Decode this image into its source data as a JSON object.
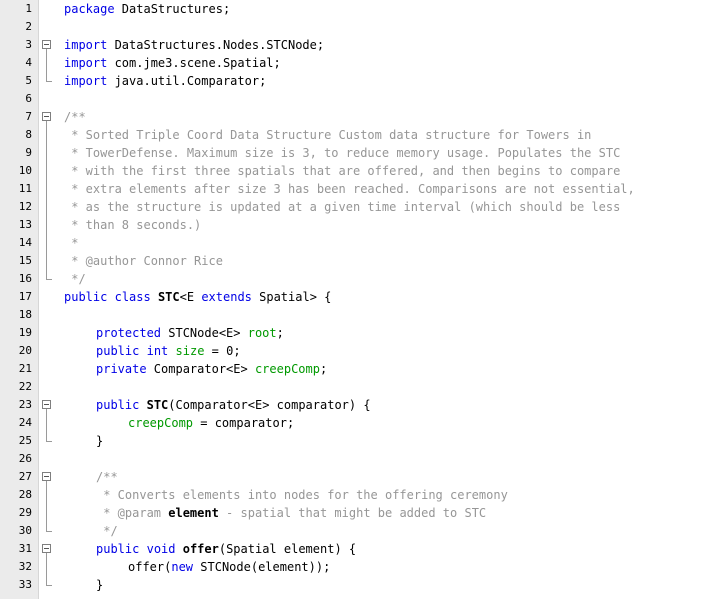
{
  "colors": {
    "keyword": "#0000e6",
    "comment": "#969696",
    "field": "#009900",
    "plain": "#000000",
    "gutter": "#ebebeb"
  },
  "lines": [
    {
      "n": "1",
      "indent": 0,
      "fold": "none",
      "t": [
        {
          "x": "package",
          "c": "kw"
        },
        {
          "x": " DataStructures;"
        }
      ]
    },
    {
      "n": "2",
      "indent": 0,
      "fold": "none",
      "t": []
    },
    {
      "n": "3",
      "indent": 0,
      "fold": "start",
      "t": [
        {
          "x": "import",
          "c": "kw"
        },
        {
          "x": " DataStructures.Nodes.STCNode;"
        }
      ]
    },
    {
      "n": "4",
      "indent": 0,
      "fold": "cont",
      "t": [
        {
          "x": "import",
          "c": "kw"
        },
        {
          "x": " com.jme3.scene.Spatial;"
        }
      ]
    },
    {
      "n": "5",
      "indent": 0,
      "fold": "end",
      "t": [
        {
          "x": "import",
          "c": "kw"
        },
        {
          "x": " java.util.Comparator;"
        }
      ]
    },
    {
      "n": "6",
      "indent": 0,
      "fold": "none",
      "t": []
    },
    {
      "n": "7",
      "indent": 0,
      "fold": "start",
      "t": [
        {
          "x": "/**",
          "c": "cm"
        }
      ]
    },
    {
      "n": "8",
      "indent": 0,
      "fold": "cont",
      "t": [
        {
          "x": " * Sorted Triple Coord Data Structure Custom data structure for Towers in",
          "c": "cm"
        }
      ]
    },
    {
      "n": "9",
      "indent": 0,
      "fold": "cont",
      "t": [
        {
          "x": " * TowerDefense. Maximum size is 3, to reduce memory usage. Populates the STC",
          "c": "cm"
        }
      ]
    },
    {
      "n": "10",
      "indent": 0,
      "fold": "cont",
      "t": [
        {
          "x": " * with the first three spatials that are offered, and then begins to compare",
          "c": "cm"
        }
      ]
    },
    {
      "n": "11",
      "indent": 0,
      "fold": "cont",
      "t": [
        {
          "x": " * extra elements after size 3 has been reached. Comparisons are not essential,",
          "c": "cm"
        }
      ]
    },
    {
      "n": "12",
      "indent": 0,
      "fold": "cont",
      "t": [
        {
          "x": " * as the structure is updated at a given time interval (which should be less",
          "c": "cm"
        }
      ]
    },
    {
      "n": "13",
      "indent": 0,
      "fold": "cont",
      "t": [
        {
          "x": " * than 8 seconds.)",
          "c": "cm"
        }
      ]
    },
    {
      "n": "14",
      "indent": 0,
      "fold": "cont",
      "t": [
        {
          "x": " *",
          "c": "cm"
        }
      ]
    },
    {
      "n": "15",
      "indent": 0,
      "fold": "cont",
      "t": [
        {
          "x": " * @author Connor Rice",
          "c": "cm"
        }
      ]
    },
    {
      "n": "16",
      "indent": 0,
      "fold": "end",
      "t": [
        {
          "x": " */",
          "c": "cm"
        }
      ]
    },
    {
      "n": "17",
      "indent": 0,
      "fold": "none",
      "t": [
        {
          "x": "public",
          "c": "kw"
        },
        {
          "x": " "
        },
        {
          "x": "class",
          "c": "kw"
        },
        {
          "x": " "
        },
        {
          "x": "STC",
          "c": "bd"
        },
        {
          "x": "<E "
        },
        {
          "x": "extends",
          "c": "kw"
        },
        {
          "x": " Spatial> {"
        }
      ]
    },
    {
      "n": "18",
      "indent": 0,
      "fold": "none",
      "t": []
    },
    {
      "n": "19",
      "indent": 1,
      "fold": "none",
      "t": [
        {
          "x": "protected",
          "c": "kw"
        },
        {
          "x": " STCNode<E> "
        },
        {
          "x": "root",
          "c": "fld"
        },
        {
          "x": ";"
        }
      ]
    },
    {
      "n": "20",
      "indent": 1,
      "fold": "none",
      "t": [
        {
          "x": "public",
          "c": "kw"
        },
        {
          "x": " "
        },
        {
          "x": "int",
          "c": "kw"
        },
        {
          "x": " "
        },
        {
          "x": "size",
          "c": "fld"
        },
        {
          "x": " = 0;"
        }
      ]
    },
    {
      "n": "21",
      "indent": 1,
      "fold": "none",
      "t": [
        {
          "x": "private",
          "c": "kw"
        },
        {
          "x": " Comparator<E> "
        },
        {
          "x": "creepComp",
          "c": "fld"
        },
        {
          "x": ";"
        }
      ]
    },
    {
      "n": "22",
      "indent": 0,
      "fold": "none",
      "t": []
    },
    {
      "n": "23",
      "indent": 1,
      "fold": "start",
      "t": [
        {
          "x": "public",
          "c": "kw"
        },
        {
          "x": " "
        },
        {
          "x": "STC",
          "c": "bd"
        },
        {
          "x": "(Comparator<E> comparator) {"
        }
      ]
    },
    {
      "n": "24",
      "indent": 2,
      "fold": "cont",
      "t": [
        {
          "x": "creepComp",
          "c": "fld"
        },
        {
          "x": " = comparator;"
        }
      ]
    },
    {
      "n": "25",
      "indent": 1,
      "fold": "end",
      "t": [
        {
          "x": "}"
        }
      ]
    },
    {
      "n": "26",
      "indent": 0,
      "fold": "none",
      "t": []
    },
    {
      "n": "27",
      "indent": 1,
      "fold": "start",
      "t": [
        {
          "x": "/**",
          "c": "cm"
        }
      ]
    },
    {
      "n": "28",
      "indent": 1,
      "fold": "cont",
      "t": [
        {
          "x": " * Converts elements into nodes for the offering ceremony",
          "c": "cm"
        }
      ]
    },
    {
      "n": "29",
      "indent": 1,
      "fold": "cont",
      "t": [
        {
          "x": " * @param ",
          "c": "cm"
        },
        {
          "x": "element",
          "c": "bd"
        },
        {
          "x": " - spatial that might be added to STC",
          "c": "cm"
        }
      ]
    },
    {
      "n": "30",
      "indent": 1,
      "fold": "end",
      "t": [
        {
          "x": " */",
          "c": "cm"
        }
      ]
    },
    {
      "n": "31",
      "indent": 1,
      "fold": "start",
      "t": [
        {
          "x": "public",
          "c": "kw"
        },
        {
          "x": " "
        },
        {
          "x": "void",
          "c": "kw"
        },
        {
          "x": " "
        },
        {
          "x": "offer",
          "c": "bd"
        },
        {
          "x": "(Spatial element) {"
        }
      ]
    },
    {
      "n": "32",
      "indent": 2,
      "fold": "cont",
      "t": [
        {
          "x": "offer("
        },
        {
          "x": "new",
          "c": "kw"
        },
        {
          "x": " STCNode(element));"
        }
      ]
    },
    {
      "n": "33",
      "indent": 1,
      "fold": "end",
      "t": [
        {
          "x": "}"
        }
      ]
    }
  ]
}
